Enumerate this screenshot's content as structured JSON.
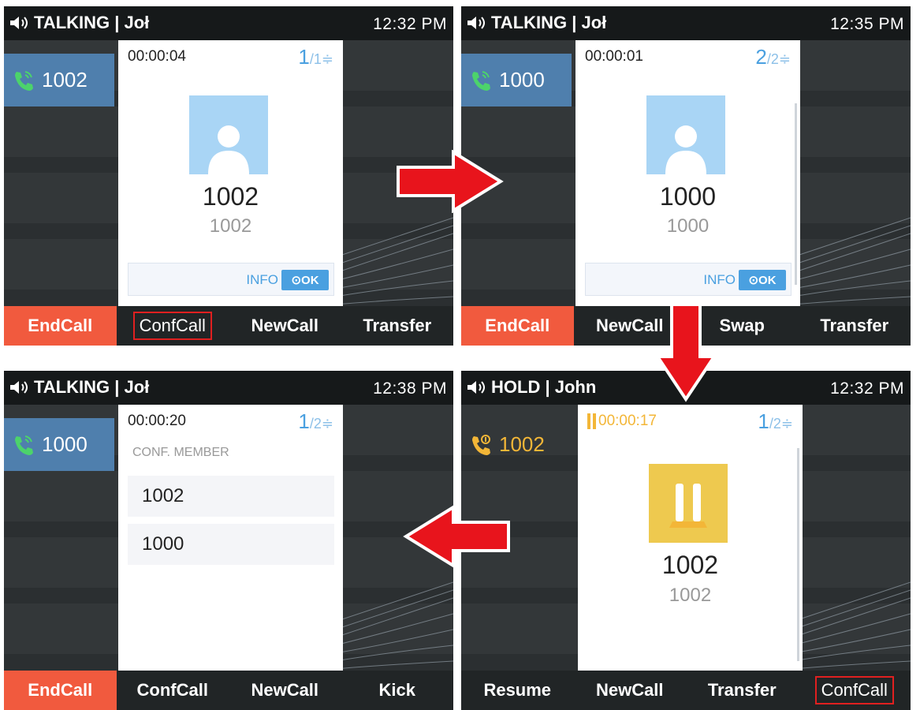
{
  "screens": [
    {
      "status": "TALKING | Joł",
      "time": "12:32 PM",
      "call_tab": "1002",
      "timer": "00:00:04",
      "counter_current": "1",
      "counter_total": "/1",
      "number_main": "1002",
      "number_sub": "1002",
      "info": "INFO",
      "ok": "OK",
      "softkeys": [
        "EndCall",
        "ConfCall",
        "NewCall",
        "Transfer"
      ]
    },
    {
      "status": "TALKING | Joł",
      "time": "12:35 PM",
      "call_tab": "1000",
      "timer": "00:00:01",
      "counter_current": "2",
      "counter_total": "/2",
      "number_main": "1000",
      "number_sub": "1000",
      "info": "INFO",
      "ok": "OK",
      "softkeys": [
        "EndCall",
        "NewCall",
        "Swap",
        "Transfer"
      ]
    },
    {
      "status": "TALKING | Joł",
      "time": "12:38 PM",
      "call_tab": "1000",
      "timer": "00:00:20",
      "counter_current": "1",
      "counter_total": "/2",
      "member_header": "CONF. MEMBER",
      "members": [
        "1002",
        "1000"
      ],
      "softkeys": [
        "EndCall",
        "ConfCall",
        "NewCall",
        "Kick"
      ]
    },
    {
      "status": "HOLD | John",
      "time": "12:32 PM",
      "call_tab": "1002",
      "timer": "00:00:17",
      "counter_current": "1",
      "counter_total": "/2",
      "number_main": "1002",
      "number_sub": "1002",
      "softkeys": [
        "Resume",
        "NewCall",
        "Transfer",
        "ConfCall"
      ]
    }
  ],
  "colors": {
    "accent_blue": "#4aa0e0",
    "end_call_red": "#f15a3e",
    "hold_yellow": "#f3b637",
    "highlight_box": "#e02020",
    "arrow_red": "#e8141c"
  }
}
